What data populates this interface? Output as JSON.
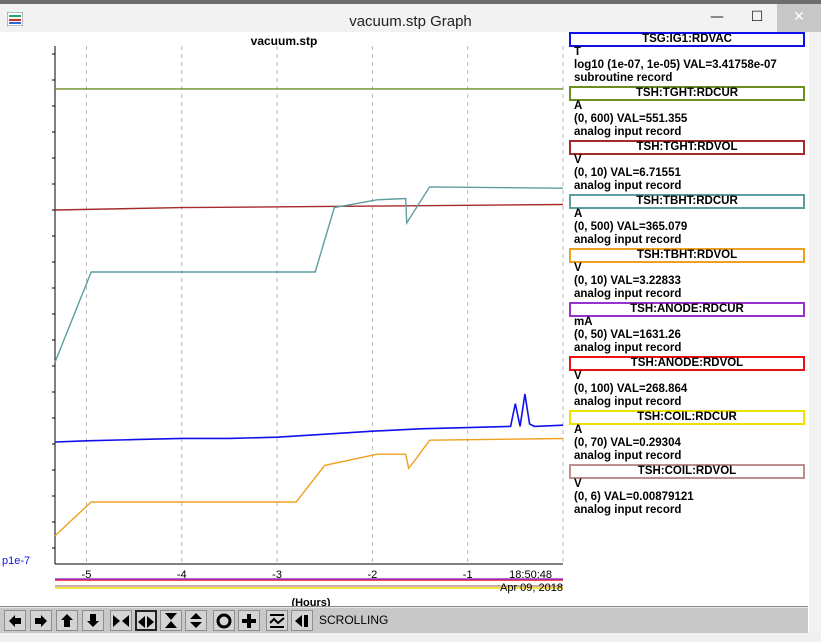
{
  "window": {
    "title": "vacuum.stp Graph",
    "minimize_glyph": "—",
    "maximize_glyph": "☐",
    "close_glyph": "✕"
  },
  "toolbar": {
    "buttons": [
      "scroll-left",
      "scroll-right",
      "scroll-up",
      "scroll-down",
      "zoom-in-horizontal",
      "zoom-out-horizontal",
      "zoom-in-vertical",
      "zoom-out-vertical",
      "center",
      "crosshair",
      "autoscale",
      "reset"
    ],
    "mode_label": "SCROLLING"
  },
  "chart_data": {
    "type": "line",
    "title": "vacuum.stp",
    "xlabel": "(Hours)",
    "x_ticks": [
      "-5",
      "-4",
      "-3",
      "-2",
      "-1"
    ],
    "x_tick_values": [
      -5,
      -4,
      -3,
      -2,
      -1
    ],
    "xlim": [
      -5.33,
      0
    ],
    "end_time": "18:50:48",
    "end_date": "Apr 09, 2018",
    "y_axis_label": "p1e-7",
    "grid": "vertical dashed",
    "legend_placement": "right",
    "series": [
      {
        "name": "TSG:IG1:RDVAC",
        "color": "#1010ee",
        "unit": "T",
        "range": "log10 (1e-07, 1e-05)",
        "value": "VAL=3.41758e-07",
        "record": "subroutine record",
        "x": [
          -5.33,
          -5.0,
          -4.5,
          -4.0,
          -3.5,
          -3.0,
          -2.6,
          -2.0,
          -1.5,
          -1.0,
          -0.55,
          -0.5,
          -0.45,
          -0.4,
          -0.35,
          -0.3,
          0.0
        ],
        "y": [
          0.2,
          0.21,
          0.22,
          0.23,
          0.23,
          0.24,
          0.26,
          0.29,
          0.31,
          0.32,
          0.33,
          0.52,
          0.33,
          0.6,
          0.35,
          0.33,
          0.34
        ]
      },
      {
        "name": "TSH:TGHT:RDCUR",
        "color": "#6b8e23",
        "unit": "A",
        "range": "(0, 600)",
        "value": "VAL=551.355",
        "record": "analog input record",
        "x": [
          -5.33,
          0.0
        ],
        "y": [
          551.4,
          551.4
        ]
      },
      {
        "name": "TSH:TGHT:RDVOL",
        "color": "#a52a2a",
        "unit": "V",
        "range": "(0, 10)",
        "value": "VAL=6.71551",
        "record": "analog input record",
        "x": [
          -5.33,
          -4.0,
          -2.0,
          0.0
        ],
        "y": [
          6.65,
          6.68,
          6.7,
          6.72
        ]
      },
      {
        "name": "TSH:TBHT:RDCUR",
        "color": "#5f9ea0",
        "unit": "A",
        "range": "(0, 500)",
        "value": "VAL=365.079",
        "record": "analog input record",
        "x": [
          -5.33,
          -4.95,
          -3.0,
          -2.6,
          -2.4,
          -1.95,
          -1.65,
          -1.64,
          -1.58,
          -1.4,
          0.0
        ],
        "y": [
          230,
          300,
          300,
          300,
          350,
          356,
          357,
          338,
          345,
          366,
          365
        ]
      },
      {
        "name": "TSH:TBHT:RDVOL",
        "color": "#f0a020",
        "unit": "V",
        "range": "(0, 10)",
        "value": "VAL=3.22833",
        "record": "analog input record",
        "x": [
          -5.33,
          -4.95,
          -4.0,
          -2.8,
          -2.5,
          -1.95,
          -1.65,
          -1.62,
          -1.55,
          -1.4,
          0.0
        ],
        "y": [
          1.5,
          2.1,
          2.1,
          2.1,
          2.75,
          2.95,
          2.95,
          2.7,
          2.85,
          3.2,
          3.23
        ]
      },
      {
        "name": "TSH:ANODE:RDCUR",
        "color": "#9932cc",
        "unit": "mA",
        "range": "(0, 50)",
        "value": "VAL=1631.26",
        "record": "analog input record",
        "x": [
          -5.33,
          0.0
        ],
        "y": [
          50,
          50
        ]
      },
      {
        "name": "TSH:ANODE:RDVOL",
        "color": "#ee1111",
        "unit": "V",
        "range": "(0, 100)",
        "value": "VAL=268.864",
        "record": "analog input record",
        "x": [
          -5.33,
          0.0
        ],
        "y": [
          100,
          100
        ]
      },
      {
        "name": "TSH:COIL:RDCUR",
        "color": "#f0e000",
        "unit": "A",
        "range": "(0, 70)",
        "value": "VAL=0.29304",
        "record": "analog input record",
        "x": [
          -5.33,
          0.0
        ],
        "y": [
          0.29,
          0.29
        ]
      },
      {
        "name": "TSH:COIL:RDVOL",
        "color": "#bc8f8f",
        "unit": "V",
        "range": "(0, 6)",
        "value": "VAL=0.00879121",
        "record": "analog input record",
        "x": [
          -5.33,
          0.0
        ],
        "y": [
          0.009,
          0.009
        ]
      }
    ]
  }
}
